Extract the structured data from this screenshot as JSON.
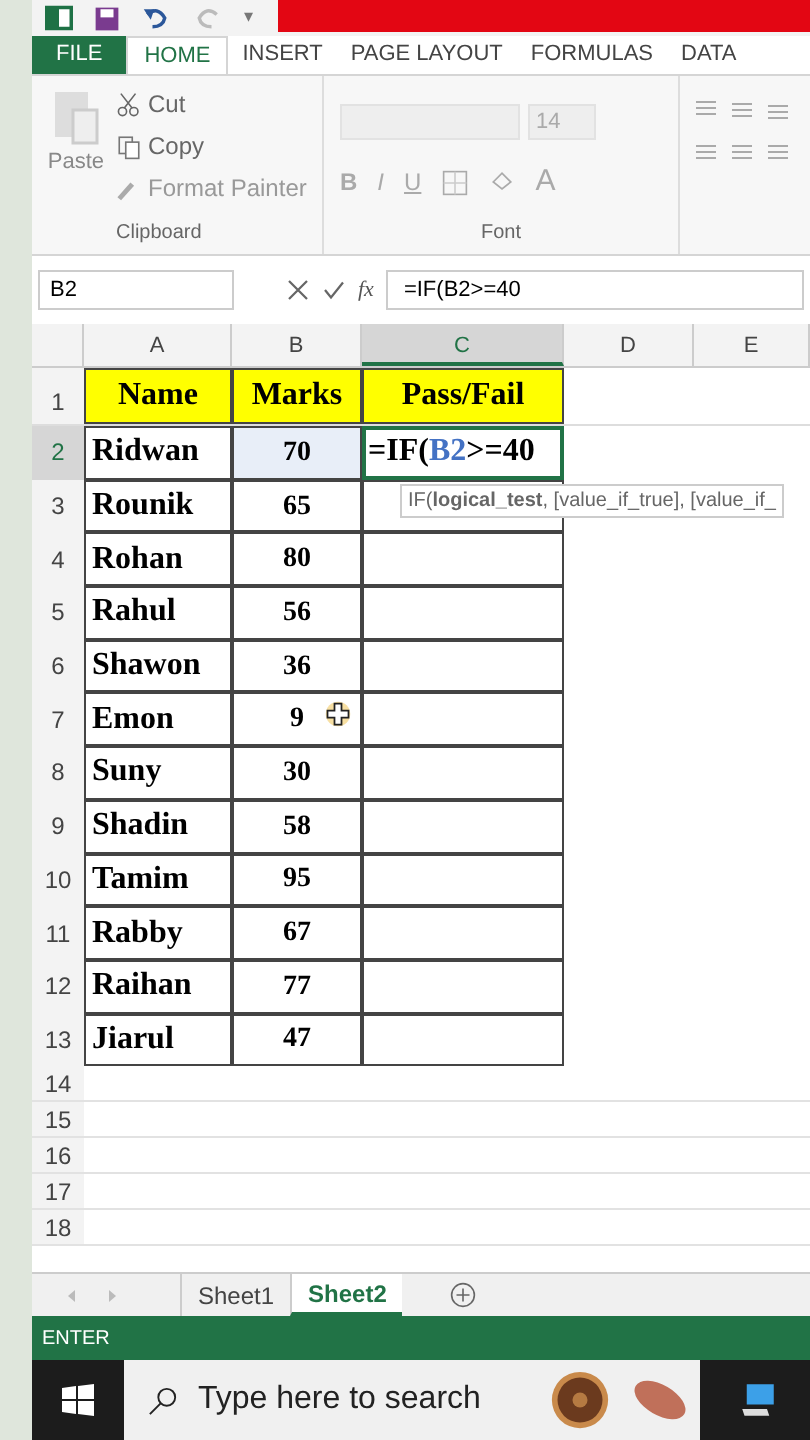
{
  "quick_access": {
    "customize": "▾"
  },
  "tabs": [
    {
      "label": "FILE",
      "kind": "file",
      "selected": false
    },
    {
      "label": "HOME",
      "kind": "tab",
      "selected": true
    },
    {
      "label": "INSERT",
      "kind": "tab",
      "selected": false
    },
    {
      "label": "PAGE LAYOUT",
      "kind": "tab",
      "selected": false
    },
    {
      "label": "FORMULAS",
      "kind": "tab",
      "selected": false
    },
    {
      "label": "DATA",
      "kind": "tab",
      "selected": false
    }
  ],
  "clipboard": {
    "paste": "Paste",
    "cut": "Cut",
    "copy": "Copy",
    "format_painter": "Format Painter",
    "label": "Clipboard"
  },
  "font": {
    "size": "14",
    "bold": "B",
    "italic": "I",
    "underline": "U",
    "font_color": "A",
    "label": "Font"
  },
  "name_box": "B2",
  "insert_function": "fx",
  "formula": "=IF(B2>=40",
  "columns": [
    {
      "label": "A",
      "selected": false
    },
    {
      "label": "B",
      "selected": false
    },
    {
      "label": "C",
      "selected": true
    },
    {
      "label": "D",
      "selected": false
    },
    {
      "label": "E",
      "selected": false
    }
  ],
  "header_row": {
    "number": "1",
    "cells": [
      "Name",
      "Marks",
      "Pass/Fail"
    ]
  },
  "rows": [
    {
      "number": "2",
      "name": "Ridwan",
      "marks": "70",
      "selected": true
    },
    {
      "number": "3",
      "name": "Rounik",
      "marks": "65",
      "selected": false
    },
    {
      "number": "4",
      "name": "Rohan",
      "marks": "80",
      "selected": false
    },
    {
      "number": "5",
      "name": "Rahul",
      "marks": "56",
      "selected": false
    },
    {
      "number": "6",
      "name": "Shawon",
      "marks": "36",
      "selected": false
    },
    {
      "number": "7",
      "name": "Emon",
      "marks": "9",
      "selected": false
    },
    {
      "number": "8",
      "name": "Suny",
      "marks": "30",
      "selected": false
    },
    {
      "number": "9",
      "name": "Shadin",
      "marks": "58",
      "selected": false
    },
    {
      "number": "10",
      "name": "Tamim",
      "marks": "95",
      "selected": false
    },
    {
      "number": "11",
      "name": "Rabby",
      "marks": "67",
      "selected": false
    },
    {
      "number": "12",
      "name": "Raihan",
      "marks": "77",
      "selected": false
    },
    {
      "number": "13",
      "name": "Jiarul",
      "marks": "47",
      "selected": false
    }
  ],
  "editing_cell": {
    "before": "=IF(",
    "reference": "B2",
    "after": ">=40"
  },
  "tooltip": "IF(**logical_test**, [value_if_true], [value_if_",
  "empty_rows": [
    "14",
    "15",
    "16",
    "17",
    "18"
  ],
  "sheets": [
    {
      "label": "Sheet1",
      "selected": false
    },
    {
      "label": "Sheet2",
      "selected": true
    }
  ],
  "status": "ENTER",
  "taskbar": {
    "search_placeholder": "Type here to search"
  }
}
